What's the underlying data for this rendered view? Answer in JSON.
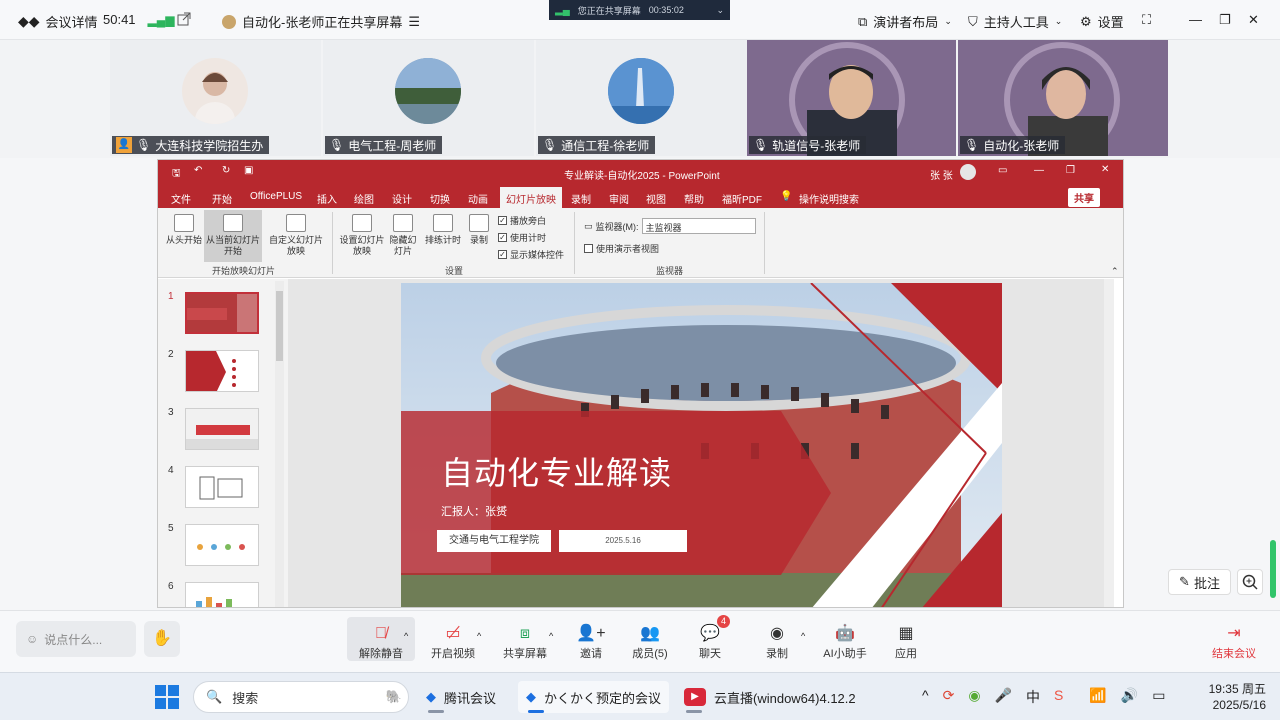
{
  "topbar": {
    "meeting_details": "会议详情",
    "duration": "50:41",
    "share_status": "自动化-张老师正在共享屏幕",
    "presenter_layout": "演讲者布局",
    "host_tools": "主持人工具",
    "settings": "设置"
  },
  "share_banner": {
    "text": "您正在共享屏幕",
    "timer": "00:35:02"
  },
  "participants": [
    {
      "name": "大连科技学院招生办"
    },
    {
      "name": "电气工程-周老师"
    },
    {
      "name": "通信工程-徐老师"
    },
    {
      "name": "轨道信号-张老师"
    },
    {
      "name": "自动化-张老师"
    }
  ],
  "ppt": {
    "title": "专业解读-自动化2025  -  PowerPoint",
    "user": "张 张",
    "tabs": [
      "文件",
      "开始",
      "OfficePLUS",
      "插入",
      "绘图",
      "设计",
      "切换",
      "动画",
      "幻灯片放映",
      "录制",
      "审阅",
      "视图",
      "帮助",
      "福昕PDF"
    ],
    "active_tab": "幻灯片放映",
    "search": "操作说明搜索",
    "share": "共享",
    "ribbon": {
      "from_start": "从头开始",
      "from_current": "从当前幻灯片开始",
      "custom": "自定义幻灯片放映",
      "group1": "开始放映幻灯片",
      "setup": "设置幻灯片放映",
      "hide": "隐藏幻灯片",
      "rehearse": "排练计时",
      "record": "录制",
      "play_narration": "播放旁白",
      "use_timings": "使用计时",
      "show_media": "显示媒体控件",
      "group2": "设置",
      "monitor_label": "监视器(M):",
      "monitor_value": "主监视器",
      "presenter_view": "使用演示者视图",
      "group3": "监视器"
    },
    "slide_numbers": [
      "1",
      "2",
      "3",
      "4",
      "5",
      "6"
    ],
    "slide": {
      "title": "自动化专业解读",
      "reporter": "汇报人：张赟",
      "college": "交通与电气工程学院",
      "date": "2025.5.16"
    }
  },
  "side_tools": {
    "annotate": "批注"
  },
  "toolbar": {
    "chat_placeholder": "说点什么...",
    "unmute": "解除静音",
    "video": "开启视频",
    "share": "共享屏幕",
    "invite": "邀请",
    "members": "成员(5)",
    "chat": "聊天",
    "chat_badge": "4",
    "record": "录制",
    "ai": "AI小助手",
    "apps": "应用",
    "end": "结束会议"
  },
  "taskbar": {
    "search": "搜索",
    "apps": [
      "腾讯会议",
      "かくかく预定的会议",
      "云直播(window64)4.12.2"
    ],
    "time": "19:35 周五",
    "date": "2025/5/16"
  },
  "colors": {
    "ppt_red": "#b7282e",
    "end_red": "#e0353b"
  }
}
